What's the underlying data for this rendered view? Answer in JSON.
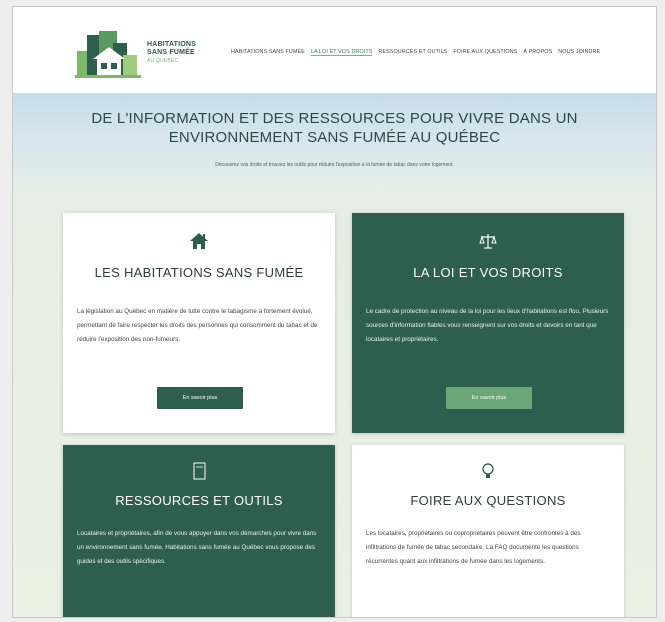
{
  "header": {
    "logo_lines": [
      "HABITATIONS",
      "SANS FUMÉE",
      "AU QUÉBEC"
    ],
    "nav": [
      {
        "label": "HABITATIONS SANS FUMÉE",
        "active": false
      },
      {
        "label": "LA LOI ET VOS DROITS",
        "active": true
      },
      {
        "label": "RESSOURCES ET OUTILS",
        "active": false
      },
      {
        "label": "FOIRE AUX QUESTIONS",
        "active": false
      },
      {
        "label": "À PROPOS",
        "active": false
      },
      {
        "label": "NOUS JOINDRE",
        "active": false
      }
    ]
  },
  "hero": {
    "title": "DE L'INFORMATION ET DES RESSOURCES POUR VIVRE DANS UN ENVIRONNEMENT SANS FUMÉE AU QUÉBEC",
    "subtitle": "Découvrez vos droits et trouvez les outils pour réduire l'exposition à la fumée de tabac dans votre logement."
  },
  "cards": [
    {
      "icon": "home-icon",
      "title": "LES HABITATIONS SANS FUMÉE",
      "text": "La législation au Québec en matière de lutte contre le tabagisme a fortement évolué, permettant de faire respecter les droits des personnes qui consomment du tabac et de réduire l'exposition des non-fumeurs.",
      "button": "En savoir plus",
      "theme": "light"
    },
    {
      "icon": "scale-icon",
      "title": "LA LOI ET VOS DROITS",
      "text": "Le cadre de protection au niveau de la loi pour les lieux d'habitations est flou. Plusieurs sources d'information fiables vous renseignent sur vos droits et devoirs en tant que locataires et propriétaires.",
      "button": "En savoir plus",
      "theme": "dark"
    },
    {
      "icon": "document-icon",
      "title": "RESSOURCES ET OUTILS",
      "text": "Locataires et propriétaires, afin de vous appuyer dans vos démarches pour vivre dans un environnement sans fumée, Habitations sans fumée au Québec vous propose des guides et des outils spécifiques.",
      "theme": "dark"
    },
    {
      "icon": "lightbulb-icon",
      "title": "FOIRE AUX QUESTIONS",
      "text": "Les locataires, propriétaires ou copropriétaires peuvent être confrontés à des infiltrations de fumée de tabac secondaire. La FAQ documente les questions récurrentes quant aux infiltrations de fumée dans les logements.",
      "theme": "light"
    }
  ],
  "colors": {
    "primary": "#2e5e4e",
    "accent": "#6aa678",
    "logo_green": "#7db86a"
  }
}
